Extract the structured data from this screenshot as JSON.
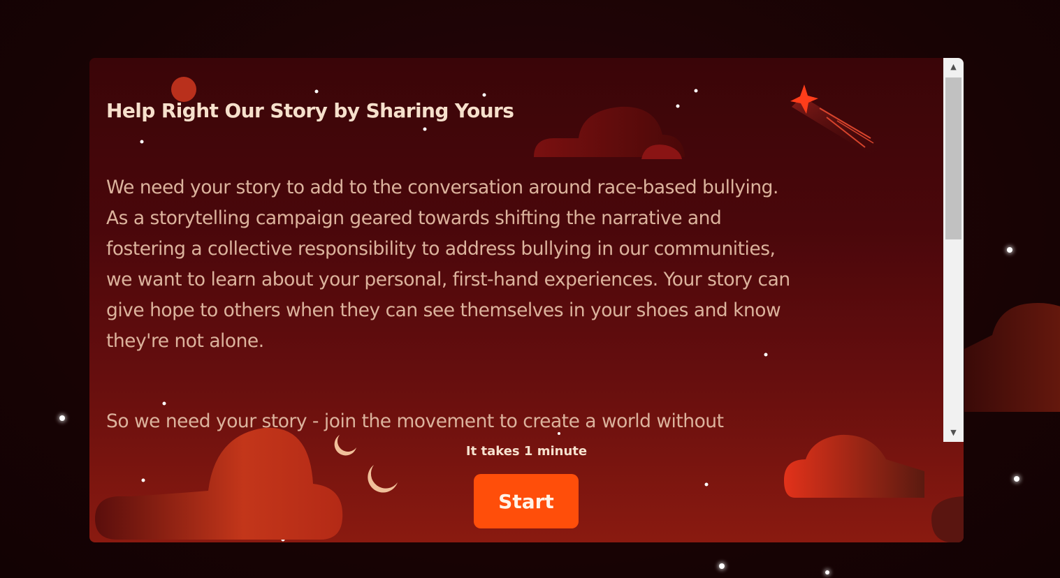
{
  "survey": {
    "title": "Help Right Our Story by Sharing Yours",
    "paragraph1_lines": [
      "We need your story to add to the conversation around race-based bullying.",
      "As a storytelling campaign geared towards shifting the narrative and",
      "fostering a collective responsibility to address bullying in our communities,",
      "we want to learn about your personal, first-hand experiences. Your story can",
      "give hope to others when they can see themselves in your shoes and know",
      "they're not alone."
    ],
    "paragraph2": "So we need your story - join the movement to create a world without",
    "duration_text": "It takes 1 minute",
    "start_label": "Start"
  },
  "scrollbar": {
    "up_arrow": "▲",
    "down_arrow": "▼"
  },
  "colors": {
    "background": "#170304",
    "card_top": "#3a0508",
    "card_bottom": "#8a1a10",
    "title_text": "#f6e0cc",
    "body_text": "#dcb39d",
    "start_button": "#ff4e0a"
  },
  "icons": [
    "star-icon",
    "shooting-star-icon",
    "crescent-moon-icon",
    "cloud-icon",
    "planet-icon"
  ]
}
